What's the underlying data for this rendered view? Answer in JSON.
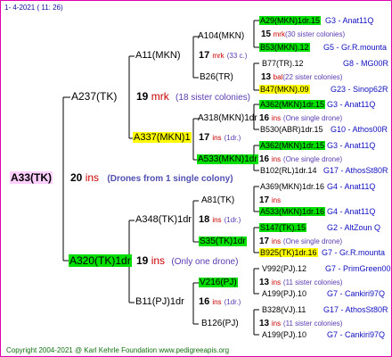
{
  "header": "1-   4-2021  ( 11:  26)",
  "footer": "Copyright 2004-2021 @ Karl Kehrle Foundation    www.pedigreeapis.org",
  "root": {
    "label": "A33(TK)",
    "num": "20",
    "mark": "ins",
    "note": "(Drones from 1 single colony)"
  },
  "level1": [
    {
      "label": "A237(TK)",
      "num": "19",
      "mark": "mrk",
      "note": "(18 sister colonies)"
    },
    {
      "label": "A320(TK)1dr",
      "num": "19",
      "mark": "ins",
      "note": "(Only one drone)"
    }
  ],
  "level2": [
    {
      "label": "A11(MKN)",
      "num": "17",
      "mark": "mrk",
      "note": "(33 c.)"
    },
    {
      "label": "A337(MKN)1",
      "num": "17",
      "mark": "ins",
      "note": "(1dr.)"
    },
    {
      "label": "A348(TK)1dr",
      "num": "18",
      "mark": "ins",
      "note": "(1dr.)"
    },
    {
      "label": "B11(PJ)1dr",
      "num": "16",
      "mark": "ins",
      "note": "(1dr.)"
    }
  ],
  "level3": [
    {
      "label": "A104(MKN)"
    },
    {
      "label": "B26(TR)"
    },
    {
      "label": "A318(MKN)1dr",
      "num": "16",
      "mark": "ins",
      "note": "(One single drone)"
    },
    {
      "label": "A533(MKN)1dr",
      "num": "16",
      "mark": "ins",
      "note": "(One single drone)"
    },
    {
      "label": "A81(TK)",
      "num": "17",
      "mark": "ins"
    },
    {
      "label": "S35(TK)1dr",
      "num": "17",
      "mark": "ins",
      "note": "(One single drone)"
    },
    {
      "label": "V216(PJ)",
      "num": "13",
      "mark": "ins",
      "note": "(11 sister colonies)"
    },
    {
      "label": "B126(PJ)",
      "num": "13",
      "mark": "ins",
      "note": "(11 sister colonies)"
    }
  ],
  "level4": [
    {
      "label": "A29(MKN)1dr.15",
      "src": "G3 - Anat11Q"
    },
    {
      "label": "15",
      "mark": "mrk",
      "note": "(30 sister colonies)"
    },
    {
      "label": "B53(MKN).12",
      "src": "G5 - Gr.R.mounta"
    },
    {
      "label": "B77(TR).12",
      "src": "G8 - MG00R"
    },
    {
      "label": "13",
      "mark": "bal",
      "note": "(22 sister colonies)"
    },
    {
      "label": "B47(MKN).09",
      "src": "G23 - Sinop62R"
    },
    {
      "label": "A362(MKN)1dr.15",
      "src": "G3 - Anat11Q"
    },
    {
      "label": "B530(ABR)1dr.15",
      "src": "G10 - Athos00R"
    },
    {
      "label": "A362(MKN)1dr.15",
      "src": "G3 - Anat11Q"
    },
    {
      "label": "B102(RL)1dr.14",
      "src": "G17 - AthosSt80R"
    },
    {
      "label": "A369(MKN)1dr.16",
      "src": "G4 - Anat11Q"
    },
    {
      "label": "A533(MKN)1dr.16",
      "src": "G4 - Anat11Q"
    },
    {
      "label": "S147(TK).15",
      "src": "G2 - AltZoun Q"
    },
    {
      "label": "B925(TK)1dr.16",
      "src": "G7 - Gr.R.mounta"
    },
    {
      "label": "V992(PJ).12",
      "src": "G7 - PrimGreen00"
    },
    {
      "label": "A199(PJ).10",
      "src": "G7 - Cankiri97Q"
    },
    {
      "label": "B328(VJ).11",
      "src": "G17 - AthosSt80R"
    },
    {
      "label": "A199(PJ).10",
      "src": "G7 - Cankiri97Q"
    }
  ],
  "colors": {
    "border": "#e000b0",
    "highlight_green": "#00e000",
    "highlight_yellow": "#ffff00",
    "root_bg": "#ffd0ff",
    "mark_red": "#c80000",
    "source_blue": "#1010c0"
  }
}
